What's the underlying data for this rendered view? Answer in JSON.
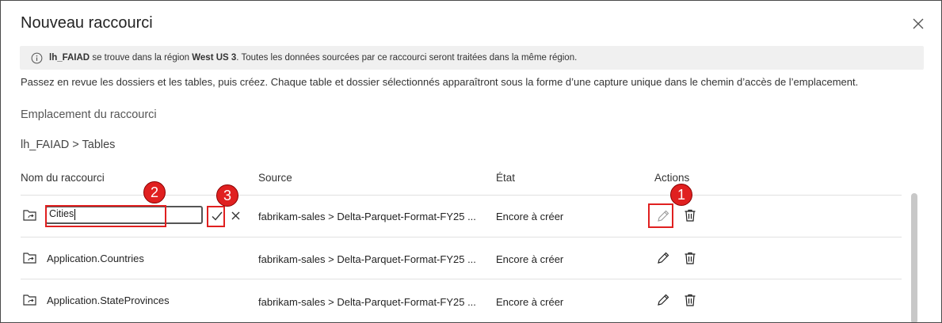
{
  "dialog": {
    "title": "Nouveau raccourci"
  },
  "banner": {
    "name": "lh_FAIAD",
    "text1": " se trouve dans la région ",
    "region": "West US 3",
    "text2": ". Toutes les données sourcées par ce raccourci seront traitées dans la même région."
  },
  "description": "Passez en revue les dossiers et les tables, puis créez. Chaque table et dossier sélectionnés apparaîtront sous la forme d’une capture unique dans le chemin d’accès de l’emplacement.",
  "section_title": "Emplacement du raccourci",
  "breadcrumb": "lh_FAIAD > Tables",
  "columns": {
    "name": "Nom du raccourci",
    "source": "Source",
    "state": "État",
    "actions": "Actions"
  },
  "rows": [
    {
      "name": "Cities",
      "source": "fabrikam-sales > Delta-Parquet-Format-FY25 ...",
      "state": "Encore à créer"
    },
    {
      "name": "Application.Countries",
      "source": "fabrikam-sales > Delta-Parquet-Format-FY25 ...",
      "state": "Encore à créer"
    },
    {
      "name": "Application.StateProvinces",
      "source": "fabrikam-sales > Delta-Parquet-Format-FY25 ...",
      "state": "Encore à créer"
    }
  ],
  "annotations": {
    "badge1": "1",
    "badge2": "2",
    "badge3": "3"
  },
  "colors": {
    "annotation_red": "#e02020",
    "banner_bg": "#f0f0f0"
  },
  "icons": [
    "close-icon",
    "info-icon",
    "shortcut-folder-icon",
    "pencil-icon",
    "trash-icon",
    "check-icon",
    "cancel-icon"
  ]
}
